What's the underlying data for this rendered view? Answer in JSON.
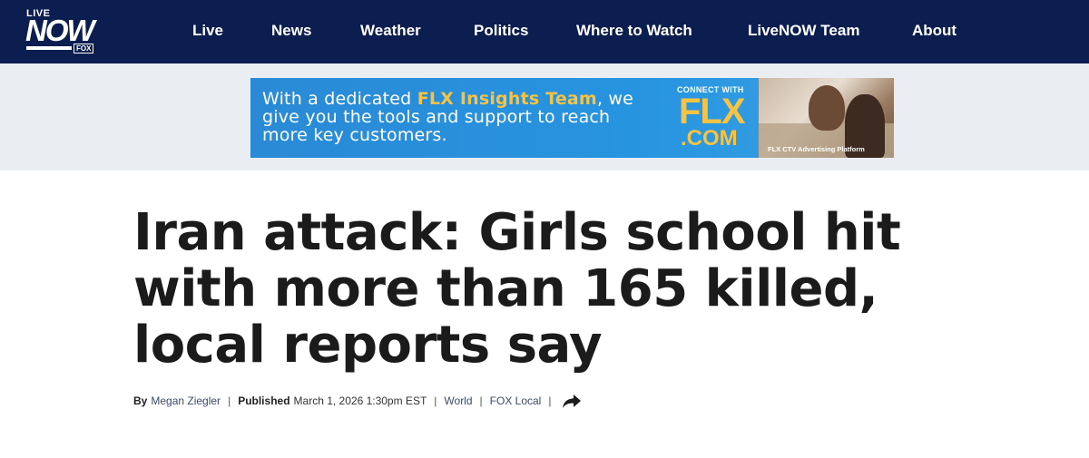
{
  "brand": {
    "logo_top": "LIVE",
    "logo_main": "NOW",
    "logo_sub": "FOX",
    "header_bg": "#0c1e4f"
  },
  "nav": {
    "items": [
      "Live",
      "News",
      "Weather",
      "Politics",
      "Where to Watch",
      "LiveNOW Team",
      "About"
    ]
  },
  "ad": {
    "text_before": "With a dedicated ",
    "text_highlight": "FLX Insights Team",
    "text_after": ", we give you the tools and support to reach more key customers.",
    "connect": "CONNECT WITH",
    "flx": "FLX",
    "com": ".COM",
    "platform": "FLX CTV Advertising Platform",
    "accent": "#f6c343"
  },
  "article": {
    "headline": "Iran attack: Girls school hit with more than 165 killed, local reports say",
    "by_label": "By",
    "author": "Megan Ziegler",
    "published_label": "Published",
    "published_date": "March 1, 2026 1:30pm EST",
    "category1": "World",
    "category2": "FOX Local",
    "separator": "|"
  },
  "icons": {
    "share": "share-arrow-icon"
  }
}
